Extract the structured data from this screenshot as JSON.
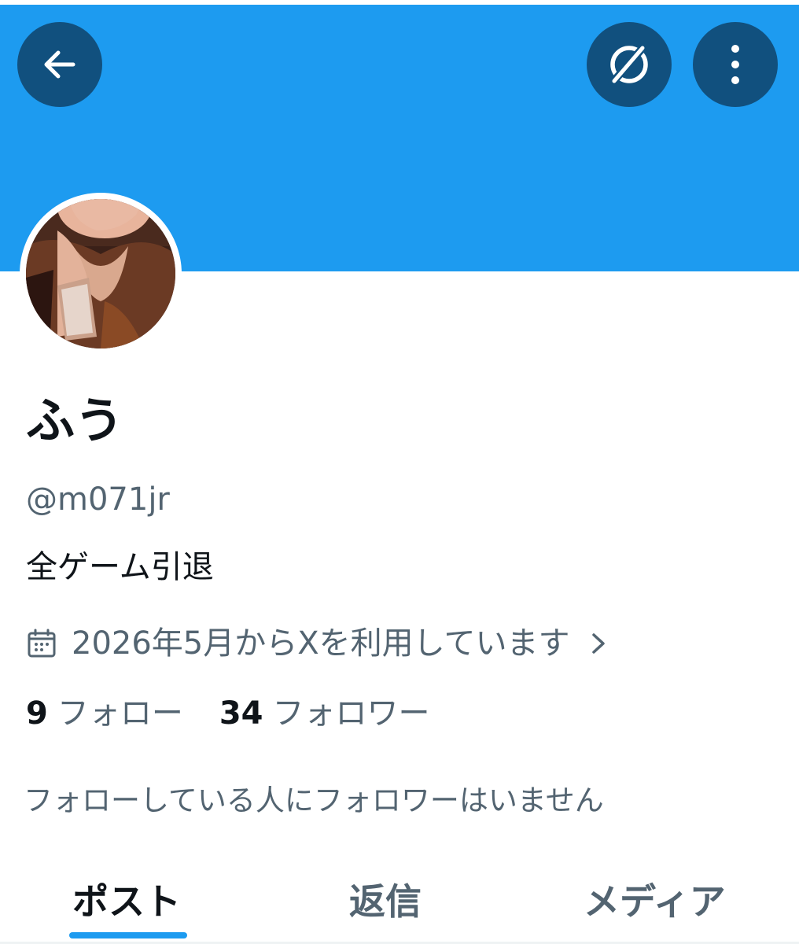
{
  "header": {
    "banner_color": "#1d9bf0",
    "back_icon": "arrow-left-icon",
    "grok_icon": "grok-icon",
    "more_icon": "more-vertical-icon"
  },
  "profile": {
    "display_name": "ふう",
    "handle": "@m071jr",
    "bio": "全ゲーム引退",
    "joined": "2026年5月からXを利用しています",
    "following_count": "9",
    "following_label": "フォロー",
    "followers_count": "34",
    "followers_label": "フォロワー",
    "mutual_note": "フォローしている人にフォロワーはいません"
  },
  "tabs": [
    {
      "label": "ポスト",
      "active": true
    },
    {
      "label": "返信",
      "active": false
    },
    {
      "label": "メディア",
      "active": false
    }
  ]
}
